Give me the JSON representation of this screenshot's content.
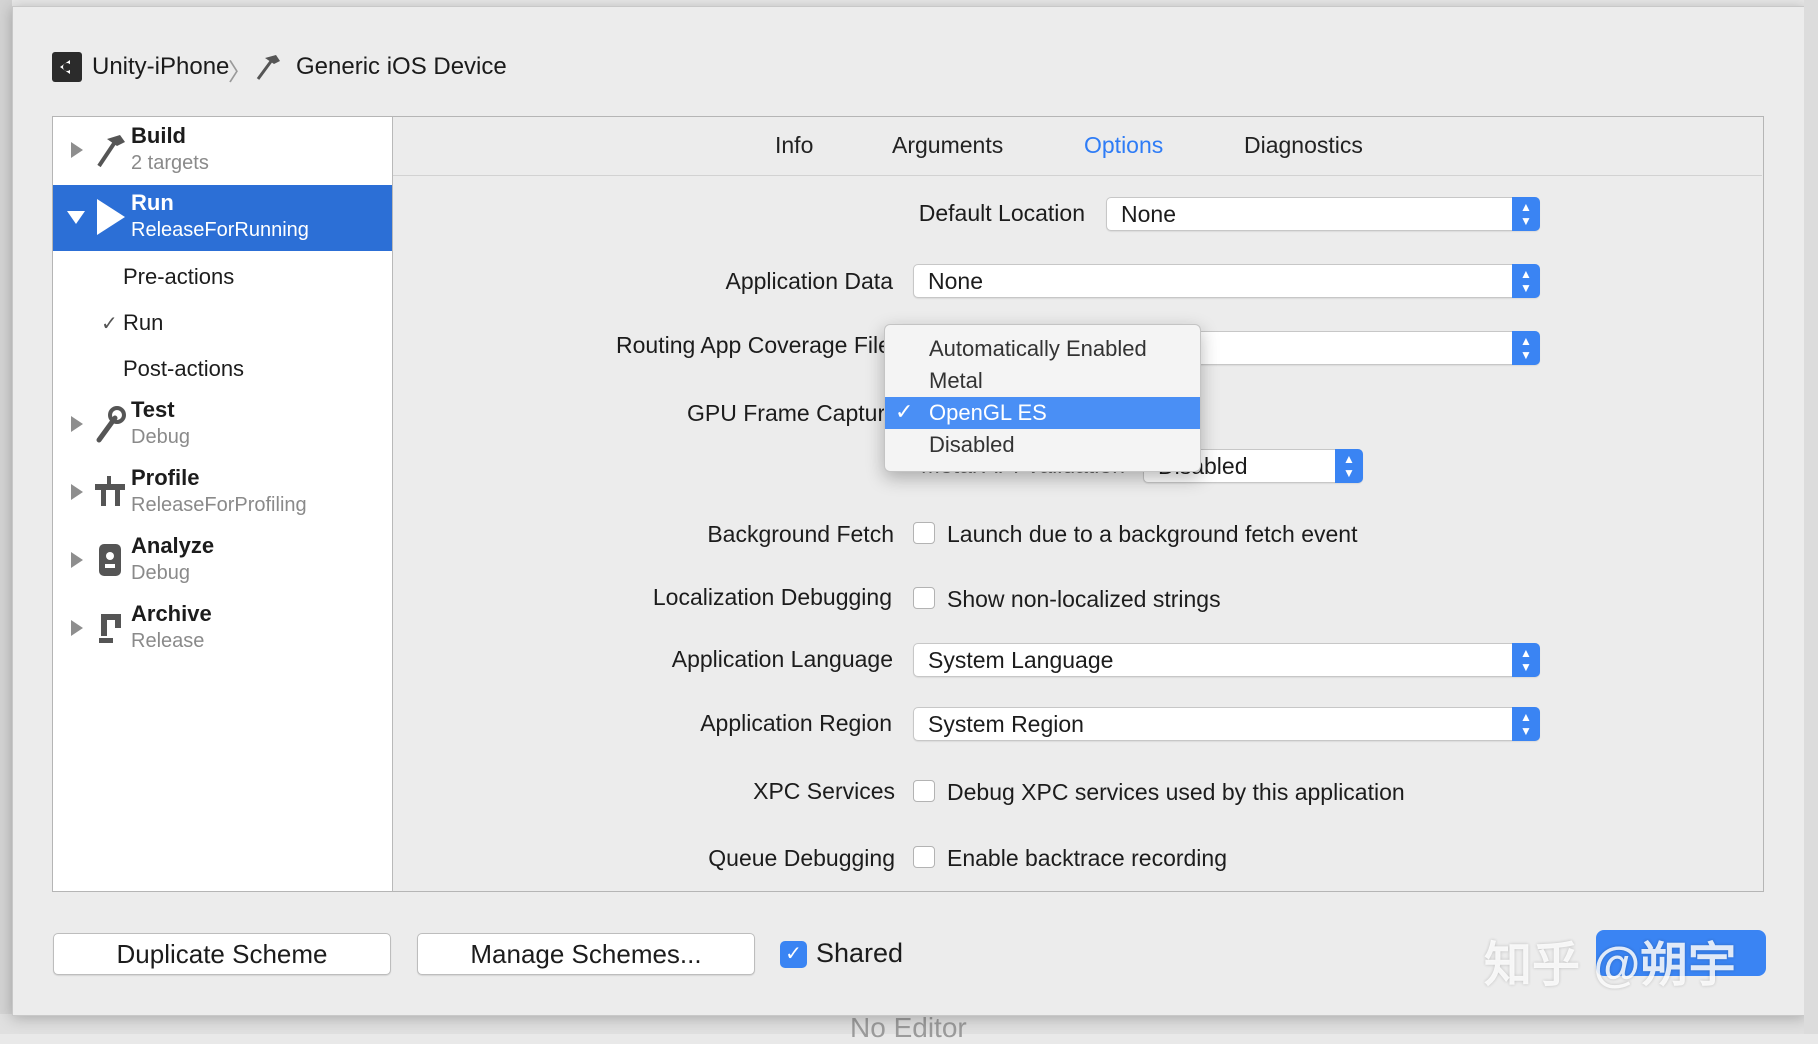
{
  "breadcrumb": {
    "scheme": "Unity-iPhone",
    "separator": "〉",
    "destination": "Generic iOS Device"
  },
  "sidebar": {
    "actions": [
      {
        "title": "Build",
        "subtitle": "2 targets",
        "icon": "hammer-icon"
      },
      {
        "title": "Run",
        "subtitle": "ReleaseForRunning",
        "icon": "play-icon",
        "selected": true,
        "children": [
          {
            "label": "Pre-actions",
            "checked": false
          },
          {
            "label": "Run",
            "checked": true
          },
          {
            "label": "Post-actions",
            "checked": false
          }
        ]
      },
      {
        "title": "Test",
        "subtitle": "Debug",
        "icon": "wrench-icon"
      },
      {
        "title": "Profile",
        "subtitle": "ReleaseForProfiling",
        "icon": "gauge-icon"
      },
      {
        "title": "Analyze",
        "subtitle": "Debug",
        "icon": "analyze-icon"
      },
      {
        "title": "Archive",
        "subtitle": "Release",
        "icon": "archive-icon"
      }
    ],
    "check_mark": "✓"
  },
  "tabs": [
    {
      "label": "Info",
      "active": false
    },
    {
      "label": "Arguments",
      "active": false
    },
    {
      "label": "Options",
      "active": true
    },
    {
      "label": "Diagnostics",
      "active": false
    }
  ],
  "options": {
    "default_location": {
      "label": "Default Location",
      "value": "None"
    },
    "application_data": {
      "label": "Application Data",
      "value": "None"
    },
    "routing_coverage": {
      "label": "Routing App Coverage File",
      "value": ""
    },
    "gpu_frame_capture": {
      "label": "GPU Frame Capture",
      "value": "OpenGL ES"
    },
    "metal_api_validation": {
      "label": "Metal API Validation",
      "value": "Disabled"
    },
    "background_fetch": {
      "label": "Background Fetch",
      "checkbox_text": "Launch due to a background fetch event",
      "checked": false
    },
    "localization_debugging": {
      "label": "Localization Debugging",
      "checkbox_text": "Show non-localized strings",
      "checked": false
    },
    "application_language": {
      "label": "Application Language",
      "value": "System Language"
    },
    "application_region": {
      "label": "Application Region",
      "value": "System Region"
    },
    "xpc_services": {
      "label": "XPC Services",
      "checkbox_text": "Debug XPC services used by this application",
      "checked": false
    },
    "queue_debugging": {
      "label": "Queue Debugging",
      "checkbox_text": "Enable backtrace recording",
      "checked": false
    }
  },
  "gpu_menu": {
    "items": [
      "Automatically Enabled",
      "Metal",
      "OpenGL ES",
      "Disabled"
    ],
    "selected_index": 2,
    "check_mark": "✓"
  },
  "footer": {
    "duplicate_label": "Duplicate Scheme",
    "manage_label": "Manage Schemes...",
    "shared_label": "Shared",
    "shared_checked": true,
    "shared_check_mark": "✓"
  },
  "watermark": "知乎 @朔宇",
  "behind_sheet_text": "No Editor",
  "colors": {
    "accent": "#3a84f3",
    "selection": "#2c6fd6",
    "menu_highlight": "#4a8ff5"
  }
}
